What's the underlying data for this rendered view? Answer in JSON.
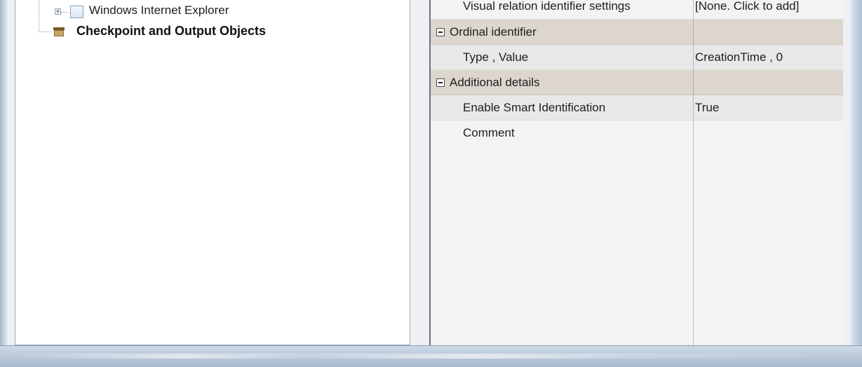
{
  "tree": {
    "items": [
      {
        "label": "Windows Internet Explorer",
        "expander": "+"
      },
      {
        "label": "Checkpoint and Output Objects"
      }
    ]
  },
  "property_grid": {
    "top_row": {
      "name": "Visual relation identifier settings",
      "value": "[None. Click to add]"
    },
    "sections": [
      {
        "title": "Ordinal identifier",
        "rows": [
          {
            "name": "Type , Value",
            "value": "CreationTime , 0"
          }
        ]
      },
      {
        "title": "Additional details",
        "rows": [
          {
            "name": "Enable Smart Identification",
            "value": "True"
          },
          {
            "name": "Comment",
            "value": ""
          }
        ]
      }
    ]
  },
  "icons": {
    "tree_expander": "plus-expander-icon",
    "ie_node": "window-icon",
    "checkpoint_node": "box-icon",
    "section_toggle": "minus-collapse-icon"
  },
  "colors": {
    "category_band": "#dcd6ce",
    "frame_blue": "#bccadb"
  }
}
